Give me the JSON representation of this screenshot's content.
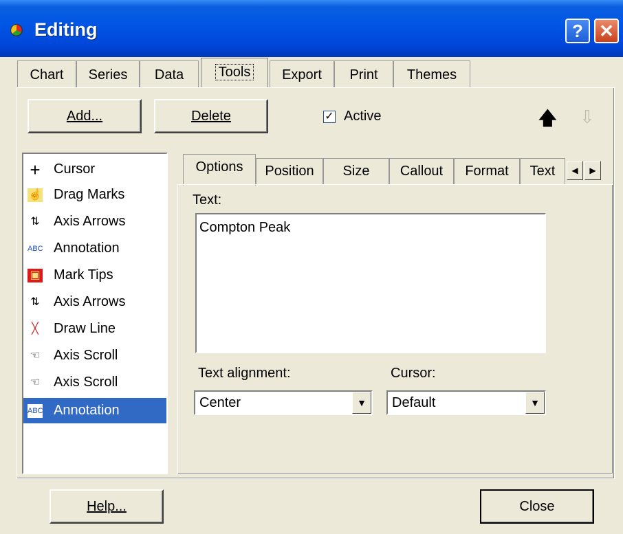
{
  "window": {
    "title": "Editing",
    "help_glyph": "?",
    "close_glyph": "✕"
  },
  "main_tabs": [
    "Chart",
    "Series",
    "Data",
    "Tools",
    "Export",
    "Print",
    "Themes"
  ],
  "toolbar": {
    "add_label": "Add...",
    "delete_label": "Delete",
    "active_label": "Active",
    "active_checked": true
  },
  "tools_list": [
    {
      "icon": "cursor-icon",
      "glyph": "+",
      "label": "Cursor"
    },
    {
      "icon": "drag-marks-icon",
      "glyph": "☝",
      "label": "Drag Marks"
    },
    {
      "icon": "axis-arrows-icon",
      "glyph": "⇅",
      "label": "Axis Arrows"
    },
    {
      "icon": "annotation-icon",
      "glyph": "ABC",
      "label": "Annotation"
    },
    {
      "icon": "mark-tips-icon",
      "glyph": "▣",
      "label": "Mark Tips"
    },
    {
      "icon": "axis-arrows-icon",
      "glyph": "⇅",
      "label": "Axis Arrows"
    },
    {
      "icon": "draw-line-icon",
      "glyph": "╳",
      "label": "Draw Line"
    },
    {
      "icon": "axis-scroll-icon",
      "glyph": "☜",
      "label": "Axis Scroll"
    },
    {
      "icon": "axis-scroll-icon",
      "glyph": "☜",
      "label": "Axis Scroll"
    },
    {
      "icon": "annotation-icon",
      "glyph": "ABC",
      "label": "Annotation",
      "selected": true
    }
  ],
  "sub_tabs": [
    "Options",
    "Position",
    "Size",
    "Callout",
    "Format",
    "Text"
  ],
  "options": {
    "text_label": "Text:",
    "text_value": "Compton Peak",
    "alignment_label": "Text alignment:",
    "alignment_value": "Center",
    "cursor_label": "Cursor:",
    "cursor_value": "Default"
  },
  "footer": {
    "help_label": "Help...",
    "close_label": "Close"
  },
  "colors": {
    "titlebar": "#0055e5",
    "selection": "#316ac5",
    "face": "#ece9d8"
  }
}
